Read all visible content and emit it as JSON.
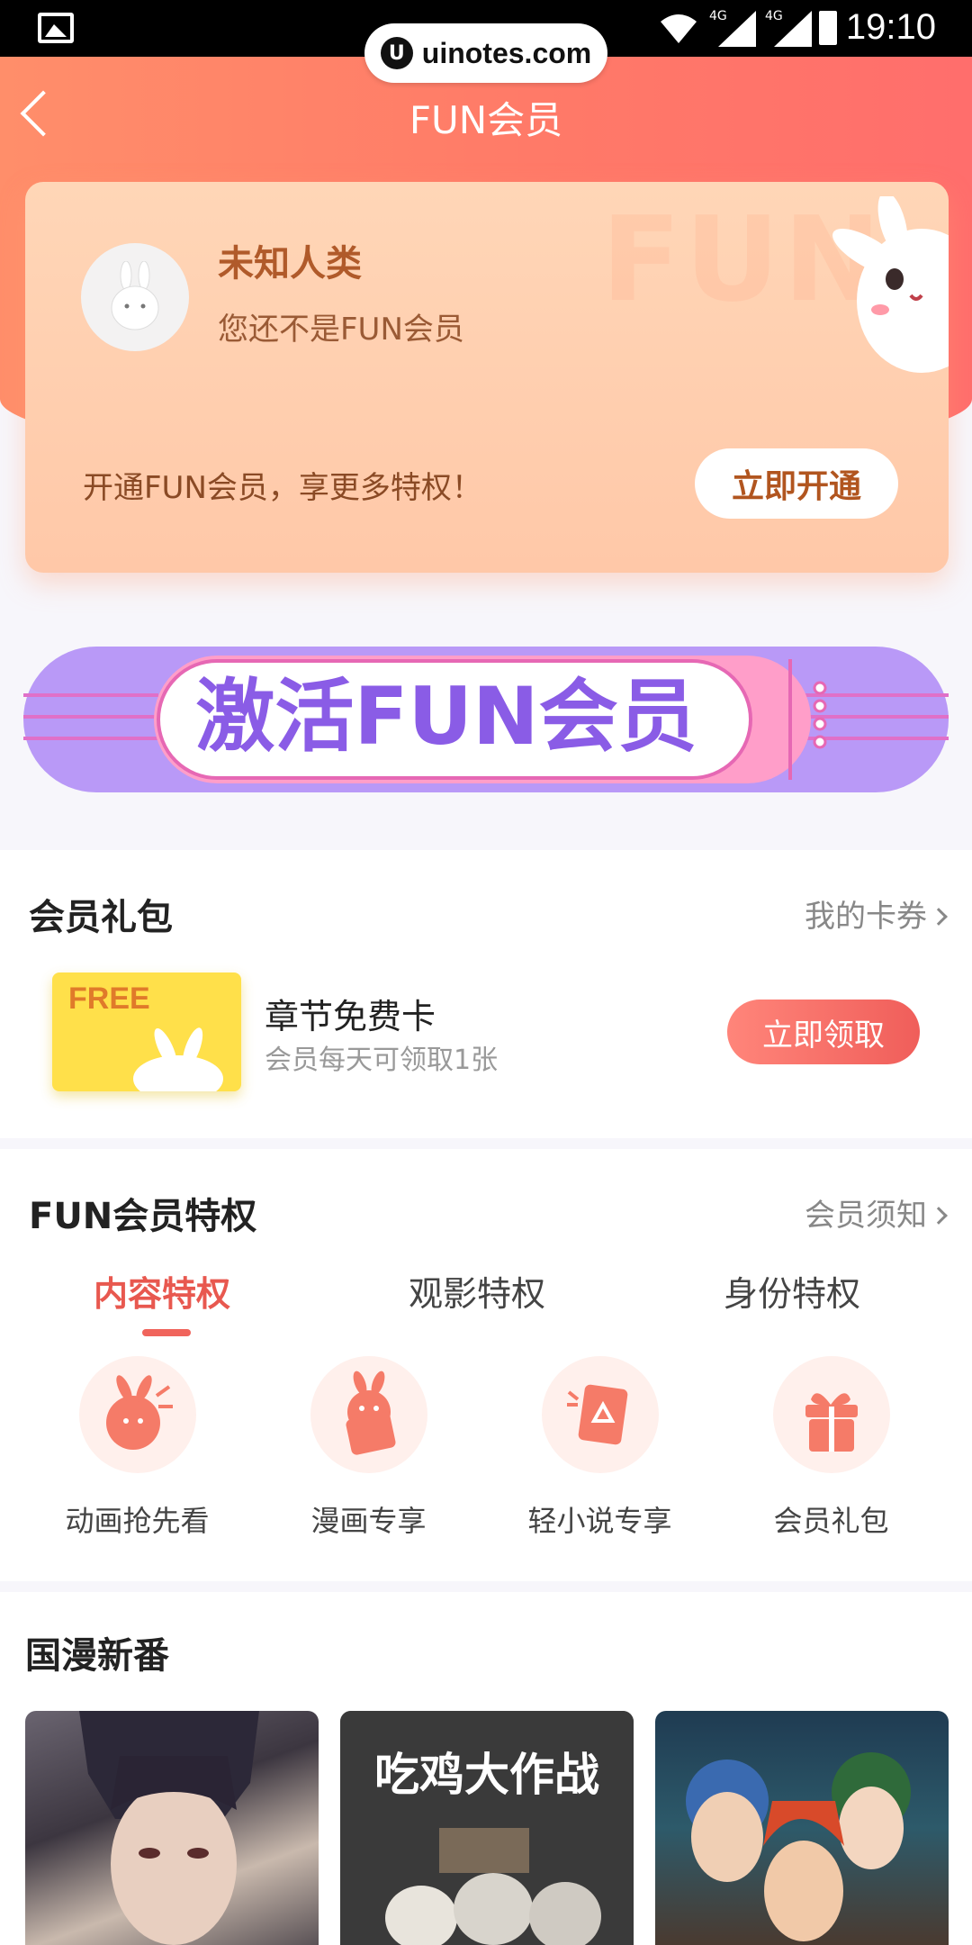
{
  "status_bar": {
    "time": "19:10",
    "network_1": "4G",
    "network_2": "4G"
  },
  "watermark": {
    "text": "uinotes.com",
    "logo": "U"
  },
  "header": {
    "title": "FUN会员"
  },
  "member_card": {
    "name": "未知人类",
    "status": "您还不是FUN会员",
    "promo": "开通FUN会员，享更多特权！",
    "open_button": "立即开通"
  },
  "activate_banner": {
    "text": "激活FUN会员"
  },
  "gift_section": {
    "title": "会员礼包",
    "link": "我的卡券",
    "card_badge": "FREE",
    "item_name": "章节免费卡",
    "item_desc": "会员每天可领取1张",
    "claim_button": "立即领取"
  },
  "privilege_section": {
    "title": "FUN会员特权",
    "link": "会员须知",
    "tabs": [
      {
        "label": "内容特权",
        "active": true
      },
      {
        "label": "观影特权",
        "active": false
      },
      {
        "label": "身份特权",
        "active": false
      }
    ],
    "perks": [
      {
        "label": "动画抢先看",
        "icon": "rabbit-bomb-icon"
      },
      {
        "label": "漫画专享",
        "icon": "free-comic-icon"
      },
      {
        "label": "轻小说专享",
        "icon": "novel-book-icon"
      },
      {
        "label": "会员礼包",
        "icon": "gift-box-icon"
      }
    ]
  },
  "new_section": {
    "title": "国漫新番",
    "posters": [
      {
        "name": "poster-1",
        "caption": ""
      },
      {
        "name": "poster-2",
        "caption": "吃鸡大作战"
      },
      {
        "name": "poster-3",
        "caption": ""
      }
    ]
  },
  "colors": {
    "accent": "#f0645c",
    "header": "#ff7a68",
    "card": "#ffcfb0",
    "banner": "#b897f5"
  }
}
